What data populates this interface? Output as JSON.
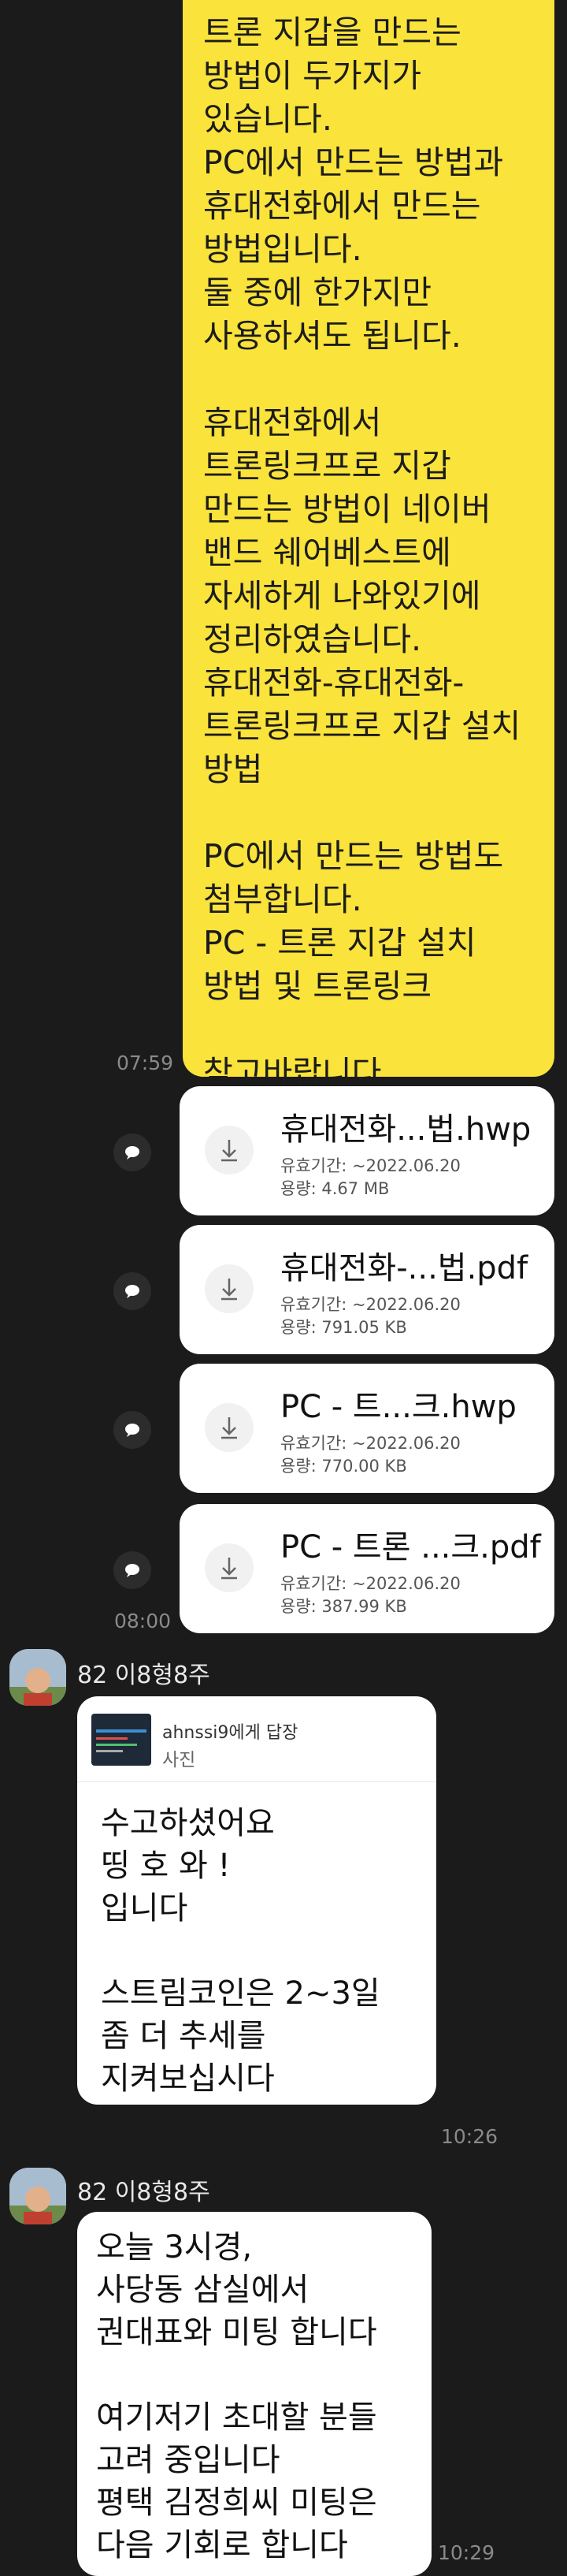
{
  "message1": {
    "lines": [
      "트론 지갑을 만드는",
      "방법이 두가지가",
      "있습니다.",
      "PC에서 만드는 방법과",
      "휴대전화에서 만드는",
      "방법입니다.",
      "둘 중에 한가지만",
      "사용하셔도 됩니다.",
      "",
      "휴대전화에서",
      "트론링크프로 지갑",
      "만드는 방법이 네이버",
      "밴드 쉐어베스트에",
      "자세하게 나와있기에",
      "정리하였습니다.",
      "휴대전화-휴대전화-",
      "트론링크프로 지갑 설치",
      "방법",
      "",
      "PC에서 만드는 방법도",
      "첨부합니다.",
      "PC - 트론 지갑 설치",
      "방법 및 트론링크",
      "",
      "참고바랍니다."
    ],
    "time": "07:59"
  },
  "files": [
    {
      "name": "휴대전화...법.hwp",
      "expiry": "유효기간: ~2022.06.20",
      "size": "용량: 4.67 MB"
    },
    {
      "name": "휴대전화-...법.pdf",
      "expiry": "유효기간: ~2022.06.20",
      "size": "용량: 791.05 KB"
    },
    {
      "name": "PC - 트...크.hwp",
      "expiry": "유효기간: ~2022.06.20",
      "size": "용량: 770.00 KB"
    },
    {
      "name": "PC - 트론 ...크.pdf",
      "expiry": "유효기간: ~2022.06.20",
      "size": "용량: 387.99 KB"
    }
  ],
  "files_time": "08:00",
  "message2": {
    "sender": "82 이8형8주",
    "reply_to": "ahnssi9에게 답장",
    "reply_type": "사진",
    "lines": [
      "수고하셨어요",
      "띵 호 와 !",
      "입니다",
      "",
      "스트림코인은 2~3일",
      "좀 더 추세를",
      "지켜보십시다"
    ],
    "time": "10:26"
  },
  "message3": {
    "sender": "82 이8형8주",
    "lines": [
      "오늘 3시경,",
      "사당동 삼실에서",
      "권대표와 미팅 합니다",
      "",
      "여기저기 초대할 분들",
      "고려 중입니다",
      "평택 김정희씨 미팅은",
      "다음 기회로 합니다"
    ],
    "time": "10:29"
  },
  "colors": {
    "background": "#1b1b1b",
    "my_bubble": "#fae33a",
    "other_bubble": "#ffffff",
    "timestamp": "#8a8a8a"
  }
}
